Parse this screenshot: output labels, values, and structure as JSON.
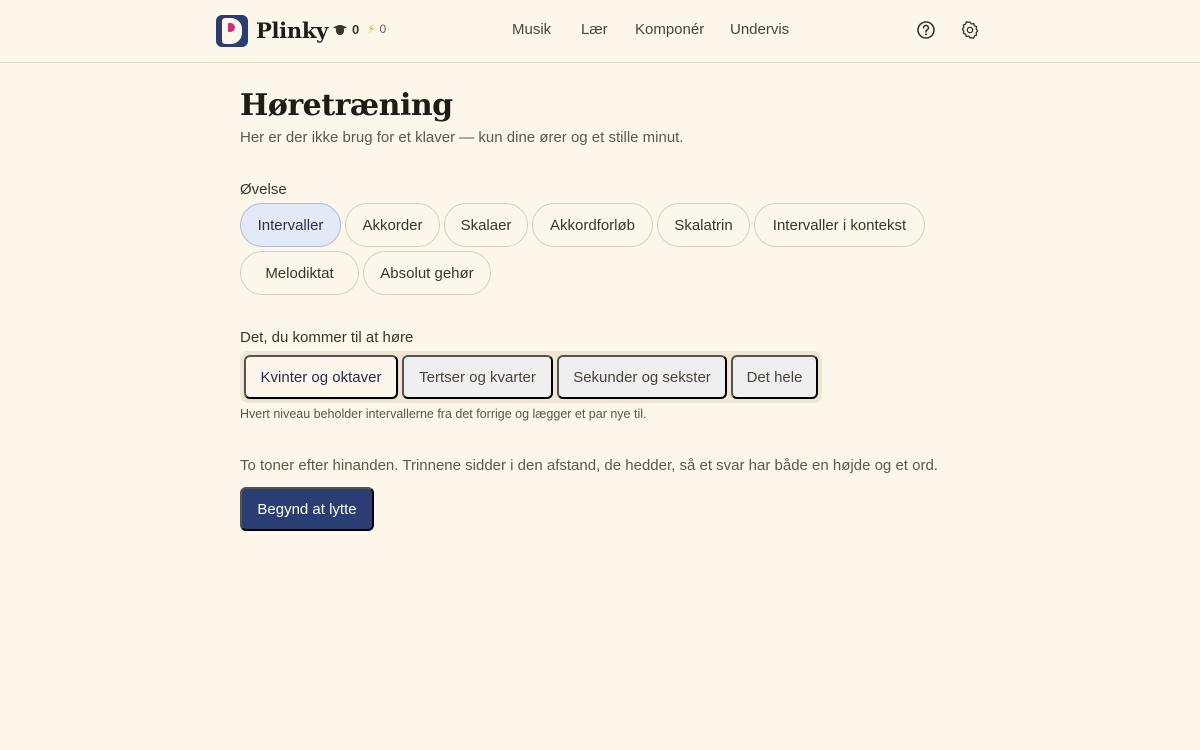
{
  "header": {
    "brand": "Plinky",
    "xp_count": "0",
    "streak_count": "0",
    "nav": [
      "Musik",
      "Lær",
      "Komponér",
      "Undervis"
    ],
    "icons": [
      "help-icon",
      "settings-icon"
    ]
  },
  "page": {
    "title": "Høretræning",
    "subtitle": "Her er der ikke brug for et klaver — kun dine ører og et stille minut."
  },
  "exercise": {
    "label": "Øvelse",
    "selected": "Intervaller",
    "options": [
      "Intervaller",
      "Akkorder",
      "Skalaer",
      "Akkordforløb",
      "Skalatrin",
      "Intervaller i kontekst",
      "Melodiktat",
      "Absolut gehør"
    ]
  },
  "level": {
    "label": "Det, du kommer til at høre",
    "selected": "Kvinter og oktaver",
    "options": [
      "Kvinter og oktaver",
      "Tertser og kvarter",
      "Sekunder og sekster",
      "Det hele"
    ],
    "hint": "Hvert niveau beholder intervallerne fra det forrige og lægger et par nye til."
  },
  "description": "To toner efter hinanden. Trinnene sidder i den afstand, de hedder, så et svar har både en højde og et ord.",
  "start_button": "Begynd at lytte",
  "colors": {
    "background": "#fcf7ea",
    "primary": "#2a3e73",
    "logo_accent": "#d12c7a",
    "selected_pill": "#e3e9f6"
  }
}
